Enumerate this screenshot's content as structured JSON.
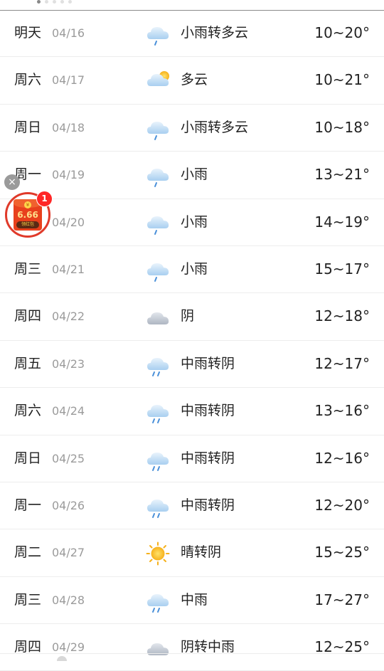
{
  "forecast": [
    {
      "day": "明天",
      "date": "04/16",
      "icon": "light-rain-icon",
      "desc": "小雨转多云",
      "temp": "10~20°"
    },
    {
      "day": "周六",
      "date": "04/17",
      "icon": "partly-cloudy-icon",
      "desc": "多云",
      "temp": "10~21°"
    },
    {
      "day": "周日",
      "date": "04/18",
      "icon": "light-rain-icon",
      "desc": "小雨转多云",
      "temp": "10~18°"
    },
    {
      "day": "周一",
      "date": "04/19",
      "icon": "light-rain-icon",
      "desc": "小雨",
      "temp": "13~21°"
    },
    {
      "day": "",
      "date": "04/20",
      "icon": "light-rain-icon",
      "desc": "小雨",
      "temp": "14~19°"
    },
    {
      "day": "周三",
      "date": "04/21",
      "icon": "light-rain-icon",
      "desc": "小雨",
      "temp": "15~17°"
    },
    {
      "day": "周四",
      "date": "04/22",
      "icon": "overcast-icon",
      "desc": "阴",
      "temp": "12~18°"
    },
    {
      "day": "周五",
      "date": "04/23",
      "icon": "moderate-rain-icon",
      "desc": "中雨转阴",
      "temp": "12~17°"
    },
    {
      "day": "周六",
      "date": "04/24",
      "icon": "moderate-rain-icon",
      "desc": "中雨转阴",
      "temp": "13~16°"
    },
    {
      "day": "周日",
      "date": "04/25",
      "icon": "moderate-rain-icon",
      "desc": "中雨转阴",
      "temp": "12~16°"
    },
    {
      "day": "周一",
      "date": "04/26",
      "icon": "moderate-rain-icon",
      "desc": "中雨转阴",
      "temp": "12~20°"
    },
    {
      "day": "周二",
      "date": "04/27",
      "icon": "sunny-icon",
      "desc": "晴转阴",
      "temp": "15~25°"
    },
    {
      "day": "周三",
      "date": "04/28",
      "icon": "moderate-rain-icon",
      "desc": "中雨",
      "temp": "17~27°"
    },
    {
      "day": "周四",
      "date": "04/29",
      "icon": "overcast-icon",
      "desc": "阴转中雨",
      "temp": "12~25°"
    }
  ],
  "promo": {
    "amount": "6.66",
    "button_text": "领红包",
    "badge_count": "1",
    "close_glyph": "×",
    "icon": "red-envelope-icon",
    "colors": {
      "envelope": "#e8401c",
      "ring": "#e03a2a",
      "badge": "#ff2626"
    }
  }
}
